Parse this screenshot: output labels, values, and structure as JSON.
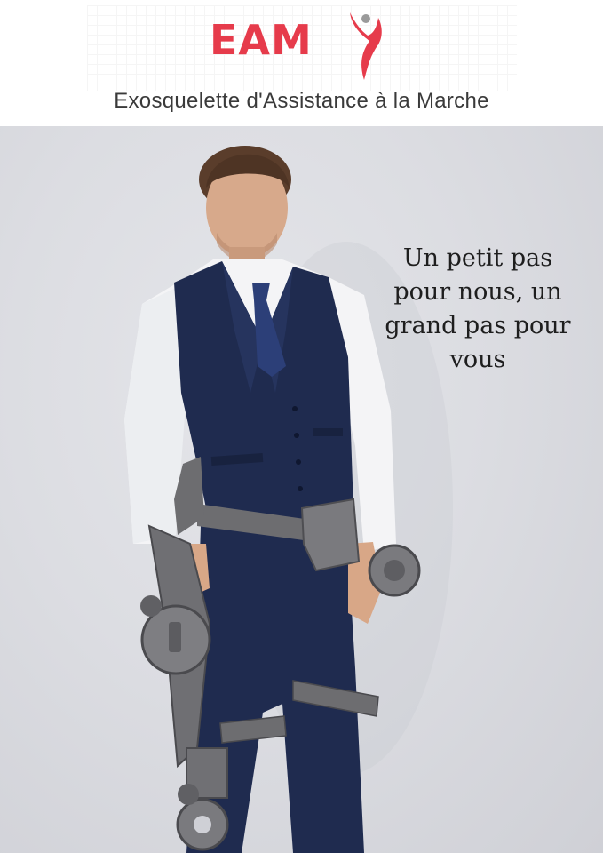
{
  "header": {
    "logo_text": "EAM",
    "subtitle": "Exosquelette d'Assistance à la Marche"
  },
  "hero": {
    "slogan_lines": [
      "Un petit pas",
      "pour nous, un",
      "grand pas pour",
      "vous"
    ]
  },
  "colors": {
    "brand_red": "#e63b4b",
    "suit_navy": "#1f2b4f",
    "shirt_white": "#f4f4f6",
    "exo_gray": "#6d6d70"
  },
  "icons": {
    "logo_mark": "walking-person-icon"
  }
}
